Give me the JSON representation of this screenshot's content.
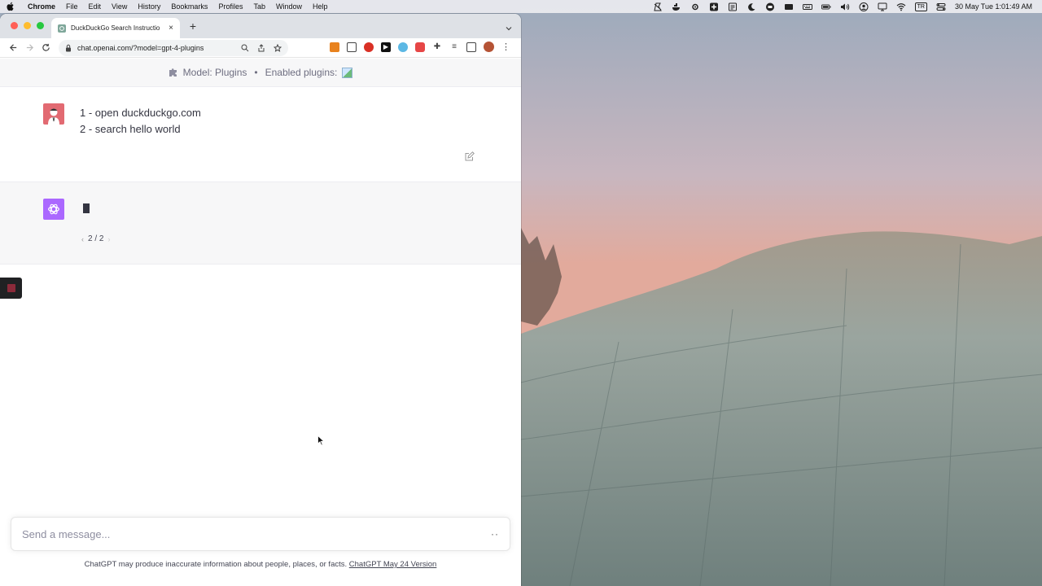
{
  "menubar": {
    "app_name": "Chrome",
    "items": [
      "File",
      "Edit",
      "View",
      "History",
      "Bookmarks",
      "Profiles",
      "Tab",
      "Window",
      "Help"
    ],
    "input_source": "TR",
    "clock": "30 May Tue  1:01:49 AM"
  },
  "browser": {
    "tab_title": "DuckDuckGo Search Instructio",
    "url": "chat.openai.com/?model=gpt-4-plugins"
  },
  "chat": {
    "model_label": "Model: Plugins",
    "separator": "•",
    "enabled_plugins_label": "Enabled plugins:",
    "user_message_line1": "1 - open duckduckgo.com",
    "user_message_line2": "2 - search hello world",
    "pager_text": "2 / 2",
    "composer_placeholder": "Send a message...",
    "composer_dots": "··",
    "disclaimer_text": "ChatGPT may produce inaccurate information about people, places, or facts.",
    "disclaimer_link": "ChatGPT May 24 Version"
  },
  "colors": {
    "bot_avatar": "#ab68ff",
    "user_avatar": "#e26a72",
    "stop_button": "#202123"
  }
}
